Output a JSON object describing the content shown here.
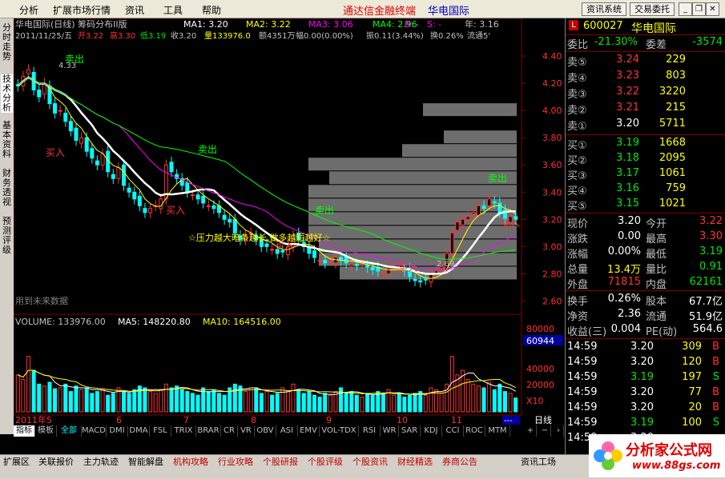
{
  "menu": {
    "items": [
      "分析",
      "扩展市场行情",
      "资讯",
      "工具",
      "帮助"
    ],
    "app_title": "通达信金融终端",
    "app_subtitle": "华电国际",
    "btn_info": "资讯系统",
    "btn_trade": "交易委托"
  },
  "left_tabs": [
    "分时走势",
    "技术分析",
    "基本资料",
    "财务透视",
    "预测评级"
  ],
  "chart_header": {
    "line1": "华电国际(日线) 筹码分布II版",
    "ma1": "MA1: 3.20",
    "ma2": "MA2: 3.22",
    "ma3": "MA3: 3.06",
    "ma4": "MA4: 2.96",
    "b": "B: -",
    "s": "S: -",
    "year": "年: 3.16",
    "line2_date": "2011/11/25/五",
    "line2_open": "开3.22",
    "line2_high": "高3.30",
    "line2_low": "低3.19",
    "line2_close": "收3.20",
    "line2_vol": "量133976.0",
    "line2_amt": "额4351万",
    "line2_amp": "幅0.00(0.00%)",
    "line2_swing": "振0.11(3.44%)",
    "line2_turn": "换0.26%",
    "line2_float": "流通5'",
    "future_text": "用到未来数据",
    "pressure_text": "☆压力越大暗条越长,做多越短越好☆"
  },
  "price_axis": [
    "4.40",
    "4.20",
    "4.00",
    "3.80",
    "3.60",
    "3.40",
    "3.20",
    "3.00",
    "2.80",
    "2.60"
  ],
  "vol_axis": [
    "80000",
    "60944",
    "40000",
    "20000",
    "X10"
  ],
  "annotations": {
    "sell": "卖出",
    "buy": "买入",
    "high": "4.33",
    "low": "2.69"
  },
  "volume_header": {
    "vol": "VOLUME: 133976.00",
    "ma5": "MA5: 148220.80",
    "ma10": "MA10: 164516.00"
  },
  "months": [
    "2011年5",
    "6",
    "7",
    "8",
    "9",
    "10",
    "11"
  ],
  "period": "日线",
  "period_flag": "---",
  "chart_data": {
    "type": "candlestick",
    "ylim": [
      2.55,
      4.5
    ],
    "vol_ylim": [
      0,
      90000
    ],
    "x_labels": [
      "2011年5",
      "6",
      "7",
      "8",
      "9",
      "10",
      "11"
    ],
    "closes": [
      4.18,
      4.25,
      4.3,
      4.15,
      4.1,
      4.2,
      4.05,
      3.98,
      4.0,
      3.92,
      3.85,
      3.78,
      3.8,
      3.7,
      3.65,
      3.6,
      3.68,
      3.55,
      3.5,
      3.58,
      3.45,
      3.4,
      3.35,
      3.3,
      3.25,
      3.28,
      3.3,
      3.35,
      3.6,
      3.55,
      3.5,
      3.45,
      3.4,
      3.38,
      3.35,
      3.32,
      3.3,
      3.28,
      3.25,
      3.2,
      3.18,
      3.1,
      3.05,
      3.08,
      3.1,
      3.05,
      3.0,
      3.0,
      2.98,
      2.95,
      2.96,
      3.0,
      3.08,
      3.05,
      3.0,
      2.95,
      2.92,
      2.9,
      2.88,
      2.9,
      2.92,
      2.9,
      2.88,
      2.87,
      2.86,
      2.88,
      2.85,
      2.83,
      2.82,
      2.8,
      2.84,
      2.86,
      2.84,
      2.82,
      2.78,
      2.75,
      2.74,
      2.76,
      2.8,
      2.82,
      2.85,
      2.95,
      3.1,
      3.18,
      3.2,
      3.22,
      3.25,
      3.3,
      3.28,
      3.35,
      3.32,
      3.25,
      3.2,
      3.22,
      3.2
    ],
    "volumes": [
      40000,
      35000,
      60000,
      45000,
      30000,
      28000,
      32000,
      25000,
      26000,
      30000,
      22000,
      28000,
      24000,
      26000,
      20000,
      22000,
      25000,
      18000,
      20000,
      26000,
      22000,
      20000,
      24000,
      28000,
      26000,
      22000,
      20000,
      24000,
      30000,
      26000,
      28000,
      24000,
      22000,
      20000,
      18000,
      26000,
      22000,
      24000,
      20000,
      18000,
      26000,
      30000,
      28000,
      22000,
      24000,
      26000,
      20000,
      22000,
      18000,
      20000,
      26000,
      22000,
      30000,
      24000,
      20000,
      22000,
      18000,
      16000,
      20000,
      18000,
      22000,
      26000,
      20000,
      22000,
      18000,
      16000,
      20000,
      18000,
      22000,
      20000,
      24000,
      18000,
      20000,
      16000,
      18000,
      20000,
      22000,
      18000,
      26000,
      24000,
      20000,
      30000,
      60000,
      40000,
      45000,
      35000,
      30000,
      28000,
      26000,
      32000,
      24000,
      30000,
      22000,
      20000,
      15000
    ],
    "chip_bars": [
      {
        "price": 4.0,
        "length": 0.45
      },
      {
        "price": 3.8,
        "length": 0.35
      },
      {
        "price": 3.7,
        "length": 0.55
      },
      {
        "price": 3.6,
        "length": 1.0
      },
      {
        "price": 3.5,
        "length": 0.9
      },
      {
        "price": 3.4,
        "length": 1.0
      },
      {
        "price": 3.3,
        "length": 1.0
      },
      {
        "price": 3.2,
        "length": 1.0
      },
      {
        "price": 3.1,
        "length": 1.0
      },
      {
        "price": 3.0,
        "length": 0.95
      },
      {
        "price": 2.9,
        "length": 0.95
      },
      {
        "price": 2.8,
        "length": 0.85
      }
    ]
  },
  "quote": {
    "code": "600027",
    "name": "华电国际",
    "weibi_label": "委比",
    "weibi": "-21.30%",
    "weicha_label": "委差",
    "weicha": "-3574",
    "asks": [
      {
        "label": "卖⑤",
        "price": "3.24",
        "vol": "229"
      },
      {
        "label": "卖④",
        "price": "3.23",
        "vol": "803"
      },
      {
        "label": "卖③",
        "price": "3.22",
        "vol": "3220"
      },
      {
        "label": "卖②",
        "price": "3.21",
        "vol": "215"
      },
      {
        "label": "卖①",
        "price": "3.20",
        "vol": "5711"
      }
    ],
    "bids": [
      {
        "label": "买①",
        "price": "3.19",
        "vol": "1668"
      },
      {
        "label": "买②",
        "price": "3.18",
        "vol": "2095"
      },
      {
        "label": "买③",
        "price": "3.17",
        "vol": "1061"
      },
      {
        "label": "买④",
        "price": "3.16",
        "vol": "759"
      },
      {
        "label": "买⑤",
        "price": "3.15",
        "vol": "1021"
      }
    ],
    "stats": [
      {
        "l1": "现价",
        "v1": "3.20",
        "c1": "wht",
        "l2": "今开",
        "v2": "3.22",
        "c2": "red"
      },
      {
        "l1": "涨跌",
        "v1": "0.00",
        "c1": "wht",
        "l2": "最高",
        "v2": "3.30",
        "c2": "red"
      },
      {
        "l1": "涨幅",
        "v1": "0.00%",
        "c1": "wht",
        "l2": "最低",
        "v2": "3.19",
        "c2": "grn"
      },
      {
        "l1": "总量",
        "v1": "13.4万",
        "c1": "yel",
        "l2": "量比",
        "v2": "0.91",
        "c2": "grn"
      },
      {
        "l1": "外盘",
        "v1": "71815",
        "c1": "red",
        "l2": "内盘",
        "v2": "62161",
        "c2": "grn"
      }
    ],
    "stats2": [
      {
        "l1": "换手",
        "v1": "0.26%",
        "l2": "股本",
        "v2": "67.7亿"
      },
      {
        "l1": "净资",
        "v1": "2.36",
        "l2": "流通",
        "v2": "51.9亿"
      },
      {
        "l1": "收益(三)",
        "v1": "0.004",
        "l2": "PE(动)",
        "v2": "564.6"
      }
    ],
    "ticks": [
      {
        "t": "14:59",
        "p": "3.20",
        "pc": "wht",
        "v": "309",
        "s": "B",
        "sc": "red"
      },
      {
        "t": "14:59",
        "p": "3.20",
        "pc": "wht",
        "v": "120",
        "s": "B",
        "sc": "red"
      },
      {
        "t": "14:59",
        "p": "3.19",
        "pc": "grn",
        "v": "197",
        "s": "S",
        "sc": "grn"
      },
      {
        "t": "14:59",
        "p": "3.20",
        "pc": "wht",
        "v": "77",
        "s": "B",
        "sc": "red"
      },
      {
        "t": "14:59",
        "p": "3.20",
        "pc": "wht",
        "v": "20",
        "s": "B",
        "sc": "red"
      },
      {
        "t": "14:59",
        "p": "3.19",
        "pc": "grn",
        "v": "100",
        "s": "S",
        "sc": "grn"
      },
      {
        "t": "14:59",
        "p": "3.20",
        "pc": "wht",
        "v": "",
        "s": "",
        "sc": "red"
      }
    ]
  },
  "indicator_tabs": [
    "指标",
    "模板",
    "全部",
    "MACD",
    "DMI",
    "DMA",
    "FSL",
    "TRIX",
    "BRAR",
    "CR",
    "VR",
    "OBV",
    "ASI",
    "EMV",
    "VOL-TDX",
    "RSI",
    "WR",
    "SAR",
    "KDJ",
    "CCI",
    "ROC",
    "MTM"
  ],
  "status_tabs": [
    "扩展区",
    "关联报价",
    "主力轨迹",
    "智能解盘",
    "机构攻略",
    "行业攻略",
    "个股研报",
    "个股评级",
    "个股资讯",
    "财经精选",
    "券商公告",
    "资讯工场"
  ],
  "watermark": {
    "brand": "分析家公式网",
    "url": "www.88gs.com"
  },
  "colors": {
    "up": "#ff3232",
    "down": "#00ffff",
    "ma1": "#ffffff",
    "ma2": "#ffff00",
    "ma3": "#ff00ff",
    "ma4": "#00ff00",
    "chip": "#808080",
    "grid": "#800000"
  }
}
